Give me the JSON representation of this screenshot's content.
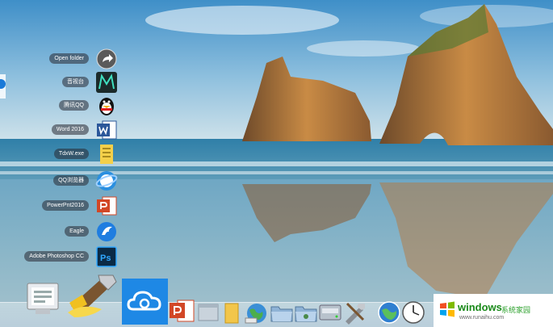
{
  "stack": {
    "items": [
      {
        "label": "Open folder",
        "icon": "curved-arrow-icon"
      },
      {
        "label": "音视台",
        "icon": "letter-m-icon"
      },
      {
        "label": "腾讯QQ",
        "icon": "penguin-icon"
      },
      {
        "label": "Word 2016",
        "icon": "word-icon"
      },
      {
        "label": "TdxW.exe",
        "icon": "document-icon"
      },
      {
        "label": "QQ浏览器",
        "icon": "qq-browser-icon"
      },
      {
        "label": "PowerPnt2016",
        "icon": "powerpoint-icon"
      },
      {
        "label": "Eagle",
        "icon": "eagle-icon"
      },
      {
        "label": "Adobe Photoshop CC",
        "icon": "photoshop-icon"
      }
    ]
  },
  "dock": {
    "icons": [
      "system-preferences-icon",
      "developer-tools-icon",
      "cloud-icon",
      "powerpoint-icon",
      "window-icon",
      "folder-icon",
      "internet-globe-icon",
      "folder-icon",
      "folder-icon",
      "drive-icon",
      "tools-icon",
      "network-globe-icon",
      "clock-icon"
    ]
  },
  "watermark": {
    "name": "windows",
    "cn": "系统家园",
    "url": "www.runaihu.com"
  },
  "colors": {
    "sky_top": "#3f8fc8",
    "sea": "#2f7fa8",
    "rock": "#b7763a",
    "watermark_green": "#1a8a1a"
  }
}
